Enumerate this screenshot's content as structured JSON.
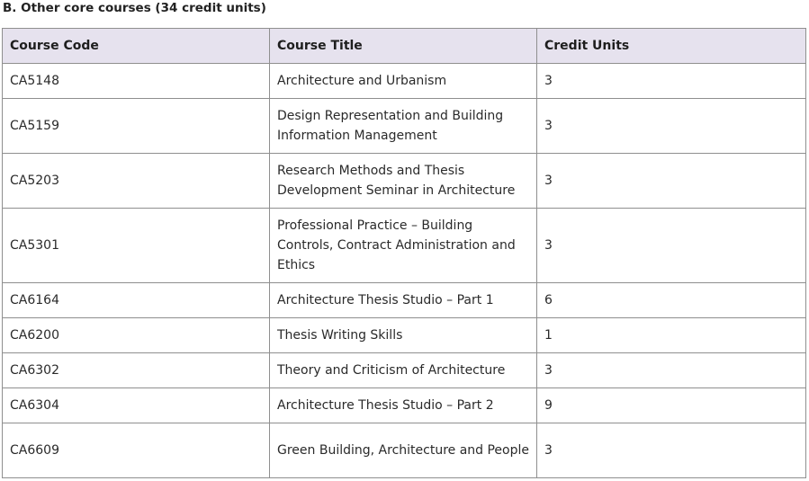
{
  "section": {
    "title": "B. Other core courses (34 credit units)"
  },
  "table": {
    "headers": [
      "Course Code",
      "Course Title",
      "Credit Units"
    ],
    "rows": [
      {
        "code": "CA5148",
        "title": "Architecture and Urbanism",
        "units": "3"
      },
      {
        "code": "CA5159",
        "title": "Design Representation and Building Information Management",
        "units": "3"
      },
      {
        "code": "CA5203",
        "title": "Research Methods and Thesis Development Seminar in Architecture",
        "units": "3"
      },
      {
        "code": "CA5301",
        "title": "Professional Practice – Building Controls, Contract Administration and Ethics",
        "units": "3"
      },
      {
        "code": "CA6164",
        "title": "Architecture Thesis Studio – Part 1",
        "units": "6"
      },
      {
        "code": "CA6200",
        "title": "Thesis Writing Skills",
        "units": "1"
      },
      {
        "code": "CA6302",
        "title": "Theory and Criticism of Architecture",
        "units": "3"
      },
      {
        "code": "CA6304",
        "title": "Architecture Thesis Studio – Part 2",
        "units": "9"
      },
      {
        "code": "CA6609",
        "title": "Green Building, Architecture and People",
        "units": "3"
      }
    ]
  }
}
